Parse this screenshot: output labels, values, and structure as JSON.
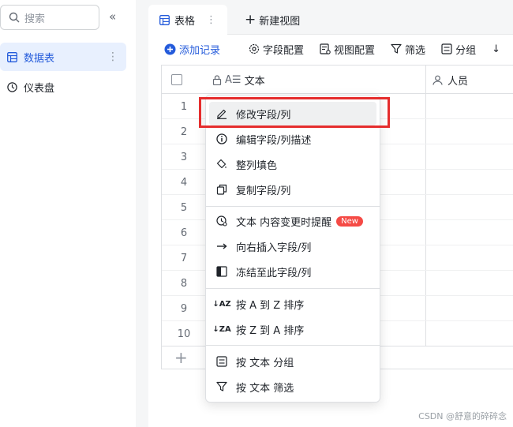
{
  "sidebar": {
    "search_placeholder": "搜索",
    "items": [
      {
        "label": "数据表",
        "icon": "table-icon",
        "active": true
      },
      {
        "label": "仪表盘",
        "icon": "dashboard-icon",
        "active": false
      }
    ]
  },
  "tabs": {
    "active_label": "表格",
    "add_label": "新建视图"
  },
  "toolbar": {
    "add_record": "添加记录",
    "field_config": "字段配置",
    "view_config": "视图配置",
    "filter": "筛选",
    "group": "分组"
  },
  "grid": {
    "columns": [
      {
        "label": "文本",
        "icon": "text-field-icon"
      },
      {
        "label": "人员",
        "icon": "person-icon"
      }
    ],
    "rows": [
      "1",
      "2",
      "3",
      "4",
      "5",
      "6",
      "7",
      "8",
      "9",
      "10"
    ]
  },
  "menu": {
    "items": [
      {
        "label": "修改字段/列",
        "icon": "edit-icon"
      },
      {
        "label": "编辑字段/列描述",
        "icon": "info-icon"
      },
      {
        "label": "整列填色",
        "icon": "paint-bucket-icon"
      },
      {
        "label": "复制字段/列",
        "icon": "copy-icon"
      },
      {
        "label": "文本 内容变更时提醒",
        "icon": "reminder-icon",
        "badge": "New"
      },
      {
        "label": "向右插入字段/列",
        "icon": "arrow-right-icon"
      },
      {
        "label": "冻结至此字段/列",
        "icon": "freeze-icon"
      },
      {
        "label": "按 A 到 Z 排序",
        "icon": "sort-asc-icon"
      },
      {
        "label": "按 Z 到 A 排序",
        "icon": "sort-desc-icon"
      },
      {
        "label": "按 文本 分组",
        "icon": "group-icon"
      },
      {
        "label": "按 文本 筛选",
        "icon": "filter-icon"
      }
    ]
  },
  "watermark": "CSDN @舒意的碎碎念",
  "colors": {
    "accent": "#245bdb",
    "highlight": "#e52d2d",
    "badge": "#f54a45"
  }
}
